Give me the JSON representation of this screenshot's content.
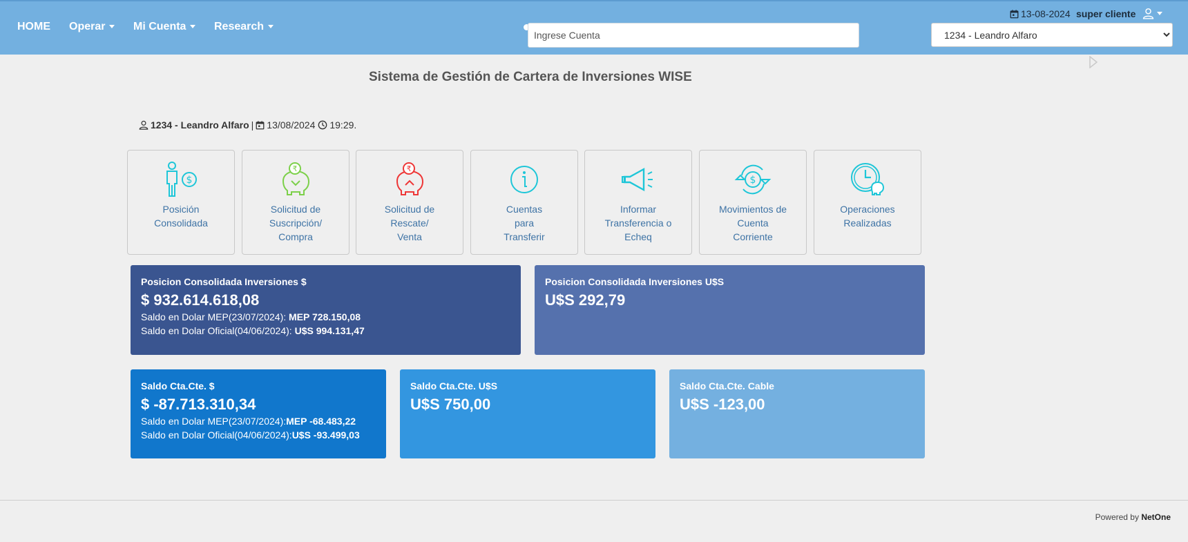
{
  "navbar": {
    "home": "HOME",
    "operar": "Operar",
    "mi_cuenta": "Mi Cuenta",
    "research": "Research",
    "search_placeholder": "Ingrese Cuenta",
    "date": "13-08-2024",
    "user": "super cliente",
    "account_selected": "1234 - Leandro Alfaro"
  },
  "page": {
    "title": "Sistema de Gestión de Cartera de Inversiones WISE",
    "account": "1234 - Leandro Alfaro",
    "date": "13/08/2024",
    "time": "19:29."
  },
  "tiles": [
    {
      "label": "Posición\nConsolidada",
      "icon": "investor-dollar-icon"
    },
    {
      "label": "Solicitud de\nSuscripción/\nCompra",
      "icon": "piggy-bank-down-icon"
    },
    {
      "label": "Solicitud de\nRescate/\nVenta",
      "icon": "piggy-bank-up-icon"
    },
    {
      "label": "Cuentas\npara\nTransferir",
      "icon": "info-icon"
    },
    {
      "label": "Informar\nTransferencia o\nEcheq",
      "icon": "megaphone-icon"
    },
    {
      "label": "Movimientos de\nCuenta\nCorriente",
      "icon": "dollar-cycle-icon"
    },
    {
      "label": "Operaciones\nRealizadas",
      "icon": "clock-piggy-icon"
    }
  ],
  "cards": {
    "inv_ars": {
      "title": "Posicion Consolidada Inversiones $",
      "amount": "$ 932.614.618,08",
      "mep_label": "Saldo en Dolar MEP(23/07/2024): ",
      "mep_value": "MEP 728.150,08",
      "oficial_label": "Saldo en Dolar Oficial(04/06/2024): ",
      "oficial_value": "U$S 994.131,47",
      "color": "#3a5590"
    },
    "inv_usd": {
      "title": "Posicion Consolidada Inversiones U$S",
      "amount": "U$S 292,79",
      "color": "#5571ad"
    },
    "cc_ars": {
      "title": "Saldo Cta.Cte. $",
      "amount": "$ -87.713.310,34",
      "mep_label": "Saldo en Dolar MEP(23/07/2024):",
      "mep_value": "MEP -68.483,22",
      "oficial_label": "Saldo en Dolar Oficial(04/06/2024):",
      "oficial_value": "U$S -93.499,03",
      "color": "#1177cc"
    },
    "cc_usd": {
      "title": "Saldo Cta.Cte. U$S",
      "amount": "U$S 750,00",
      "color": "#3396e0"
    },
    "cc_cable": {
      "title": "Saldo Cta.Cte. Cable",
      "amount": "U$S -123,00",
      "color": "#74b0e0"
    }
  },
  "footer": {
    "prefix": "Powered by ",
    "brand": "NetOne"
  }
}
